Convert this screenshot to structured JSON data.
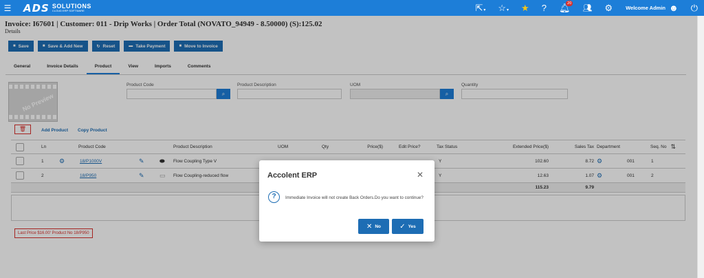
{
  "topbar": {
    "menu_icon": "hamburger-icon",
    "logo_mark": "ADS",
    "logo_name": "SOLUTIONS",
    "logo_tagline": "CLOUD ERP SOFTWARE",
    "notification_count": "20",
    "welcome": "Welcome Admin",
    "color": "#1d7ed8"
  },
  "page": {
    "title": "Invoice: I67601 | Customer: 011 - Drip Works | Order Total (NOVATO_94949 - 8.50000) (S):125.02",
    "subtitle": "Details"
  },
  "toolbar": {
    "save": "Save",
    "save_add_new": "Save & Add New",
    "reset": "Reset",
    "take_payment": "Take Payment",
    "move_to_invoice": "Move to Invoice"
  },
  "tabs": [
    "General",
    "Invoice Details",
    "Product",
    "View",
    "Imports",
    "Comments"
  ],
  "preview_text": "No Preview",
  "fields": {
    "product_code": "Product Code",
    "product_description": "Product Description",
    "uom": "UOM",
    "quantity": "Quantity"
  },
  "actions": {
    "add_product": "Add Product",
    "copy_product": "Copy Product"
  },
  "grid": {
    "headers": {
      "ln": "Ln",
      "product_code": "Product Code",
      "product_description": "Product Description",
      "uom": "UOM",
      "qty": "Qty",
      "price": "Price($)",
      "edit_price": "Edit Price?",
      "tax_status": "Tax Status",
      "extended_price": "Extended Price($)",
      "sales_tax": "Sales Tax",
      "department": "Department",
      "seq_no": "Seq. No"
    },
    "rows": [
      {
        "ln": "1",
        "code": "18/P1000V",
        "description": "Flow Coupling Type V",
        "tax": "Y",
        "extended": "102.60",
        "sales_tax": "8.72",
        "dept": "001",
        "seq": "1"
      },
      {
        "ln": "2",
        "code": "18/P950",
        "description": "Flow Coupling-reduced flow",
        "tax": "Y",
        "extended": "12.63",
        "sales_tax": "1.07",
        "dept": "001",
        "seq": "2"
      }
    ],
    "totals": {
      "extended": "115.23",
      "sales_tax": "9.79"
    }
  },
  "last_price": "Last Price $16.00' Product No 18/P950",
  "modal": {
    "title": "Accolent ERP",
    "message": "Immediate Invoice will not create Back Orders.Do you want to continue?",
    "no": "No",
    "yes": "Yes"
  }
}
